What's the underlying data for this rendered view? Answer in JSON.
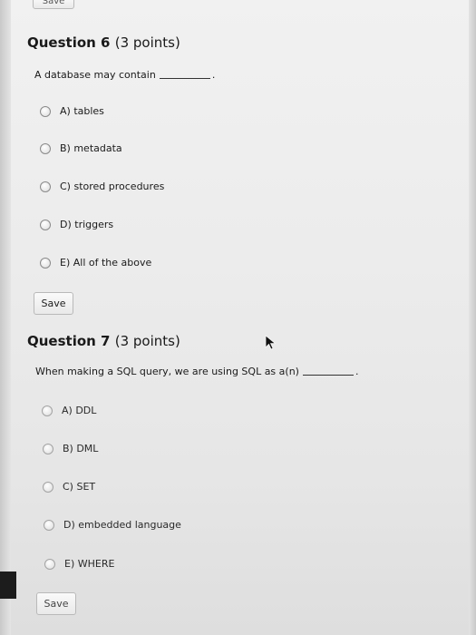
{
  "top_button": {
    "label": "Save"
  },
  "question6": {
    "number_label": "Question 6",
    "points": "(3 points)",
    "text": "A database may contain",
    "text_end": ".",
    "options": [
      "A) tables",
      "B) metadata",
      "C) stored procedures",
      "D) triggers",
      "E) All of the above"
    ],
    "save_label": "Save"
  },
  "question7": {
    "number_label": "Question 7",
    "points": "(3 points)",
    "text": "When making a SQL query, we are using SQL as a(n)",
    "text_end": ".",
    "options": [
      "A) DDL",
      "B) DML",
      "C) SET",
      "D) embedded language",
      "E) WHERE"
    ],
    "save_label": "Save"
  },
  "icons": {
    "radio": "radio-button-icon",
    "cursor": "mouse-pointer-icon"
  }
}
